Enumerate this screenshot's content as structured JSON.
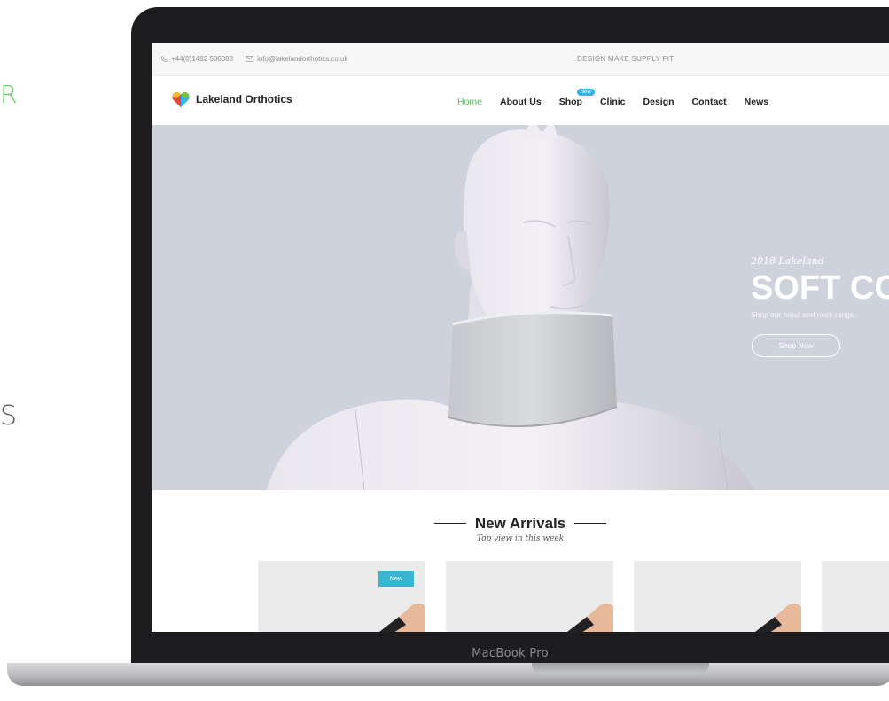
{
  "side_glyphs": [
    "R",
    "S"
  ],
  "device": {
    "label": "MacBook Pro"
  },
  "topbar": {
    "phone": "+44(0)1482 586088",
    "email": "info@lakelandorthotics.co.uk",
    "tagline": "DESIGN MAKE SUPPLY FIT"
  },
  "brand": {
    "name": "Lakeland Orthotics"
  },
  "nav": {
    "home": "Home",
    "about": "About Us",
    "shop": "Shop",
    "shop_badge": "New",
    "clinic": "Clinic",
    "design": "Design",
    "contact": "Contact",
    "news": "News",
    "active_color": "#5cb85c"
  },
  "hero": {
    "kicker": "2018 Lakeland",
    "headline": "SOFT CO",
    "subtext": "Shop our head and neck range,",
    "cta": "Shop Now",
    "background_color": "#cdd2dc"
  },
  "arrivals": {
    "title": "New Arrivals",
    "subtitle": "Top view in this week",
    "cards": [
      {
        "badge": "New"
      },
      {
        "badge": ""
      },
      {
        "badge": ""
      },
      {
        "badge": ""
      }
    ],
    "badge_color": "#3ab4cf"
  }
}
